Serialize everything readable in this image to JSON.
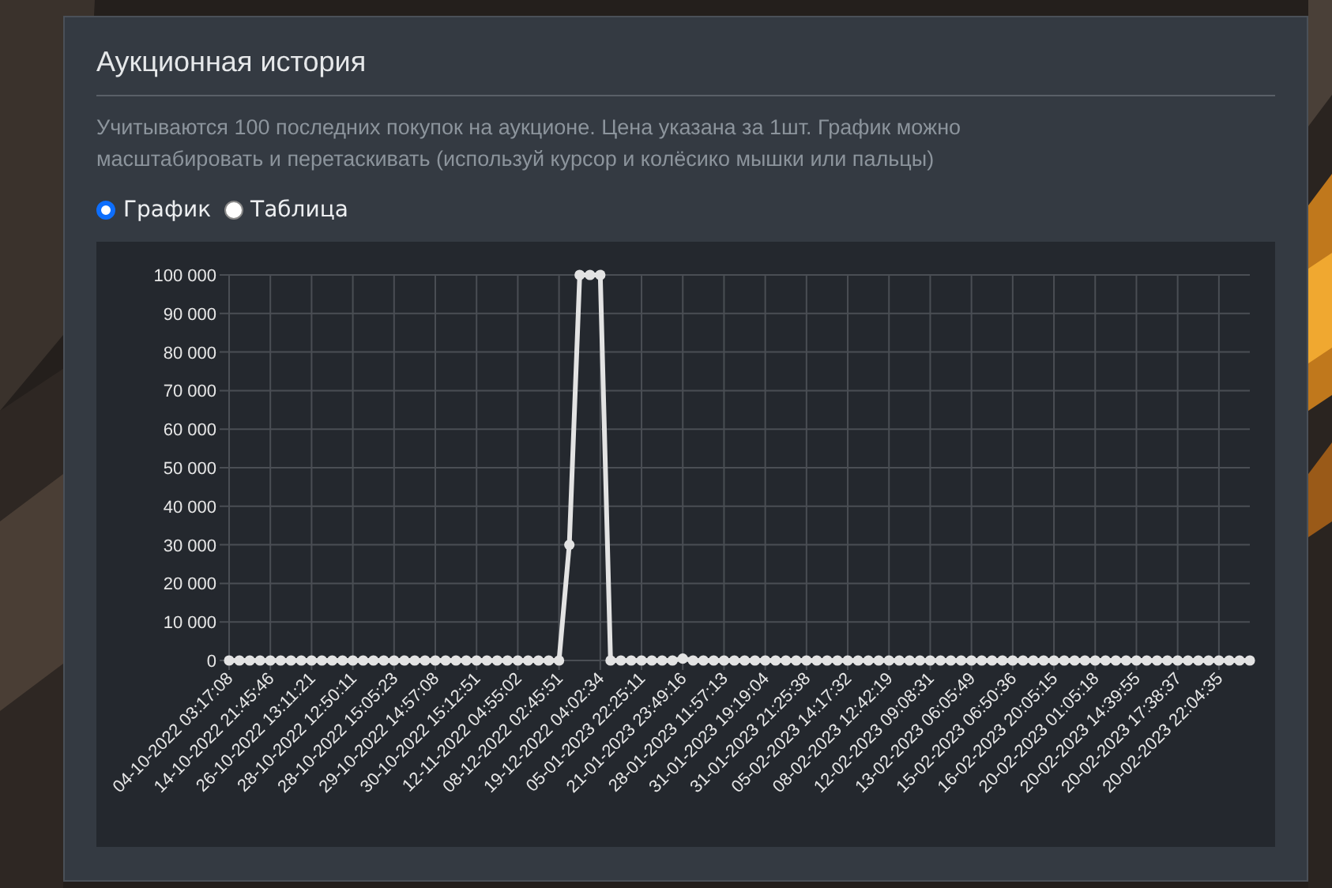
{
  "panel": {
    "title": "Аукционная история",
    "description": "Учитываются 100 последних покупок на аукционе. Цена указана за 1шт. График можно масштабировать и перетаскивать (используй курсор и колёсико мышки или пальцы)",
    "view_options": [
      {
        "label": "График",
        "selected": true
      },
      {
        "label": "Таблица",
        "selected": false
      }
    ],
    "chart_data": {
      "type": "line",
      "grid": true,
      "ylim": [
        0,
        100000
      ],
      "yticks": [
        {
          "value": 0,
          "label": "0"
        },
        {
          "value": 10000,
          "label": "10 000"
        },
        {
          "value": 20000,
          "label": "20 000"
        },
        {
          "value": 30000,
          "label": "30 000"
        },
        {
          "value": 40000,
          "label": "40 000"
        },
        {
          "value": 50000,
          "label": "50 000"
        },
        {
          "value": 60000,
          "label": "60 000"
        },
        {
          "value": 70000,
          "label": "70 000"
        },
        {
          "value": 80000,
          "label": "80 000"
        },
        {
          "value": 90000,
          "label": "90 000"
        },
        {
          "value": 100000,
          "label": "100 000"
        }
      ],
      "categories": [
        "04-10-2022 03:17:08",
        null,
        null,
        null,
        "14-10-2022 21:45:46",
        null,
        null,
        null,
        "26-10-2022 13:11:21",
        null,
        null,
        null,
        "28-10-2022 12:50:11",
        null,
        null,
        null,
        "28-10-2022 15:05:23",
        null,
        null,
        null,
        "29-10-2022 14:57:08",
        null,
        null,
        null,
        "30-10-2022 15:12:51",
        null,
        null,
        null,
        "12-11-2022 04:55:02",
        null,
        null,
        null,
        "08-12-2022 02:45:51",
        null,
        null,
        null,
        "19-12-2022 04:02:34",
        null,
        null,
        null,
        "05-01-2023 22:25:11",
        null,
        null,
        null,
        "21-01-2023 23:49:16",
        null,
        null,
        null,
        "28-01-2023 11:57:13",
        null,
        null,
        null,
        "31-01-2023 19:19:04",
        null,
        null,
        null,
        "31-01-2023 21:25:38",
        null,
        null,
        null,
        "05-02-2023 14:17:32",
        null,
        null,
        null,
        "08-02-2023 12:42:19",
        null,
        null,
        null,
        "12-02-2023 09:08:31",
        null,
        null,
        null,
        "13-02-2023 06:05:49",
        null,
        null,
        null,
        "15-02-2023 06:50:36",
        null,
        null,
        null,
        "16-02-2023 20:05:15",
        null,
        null,
        null,
        "20-02-2023 01:05:18",
        null,
        null,
        null,
        "20-02-2023 14:39:55",
        null,
        null,
        null,
        "20-02-2023 17:38:37",
        null,
        null,
        null,
        "20-02-2023 22:04:35",
        null,
        null,
        null
      ],
      "series": [
        {
          "color": "#e3e3e3",
          "marker": "circle",
          "values": [
            0,
            0,
            0,
            0,
            0,
            0,
            0,
            0,
            0,
            0,
            0,
            0,
            0,
            0,
            0,
            0,
            0,
            0,
            0,
            0,
            0,
            0,
            0,
            0,
            0,
            0,
            0,
            0,
            0,
            0,
            0,
            0,
            0,
            30000,
            100000,
            100000,
            100000,
            0,
            0,
            0,
            0,
            0,
            0,
            0,
            500,
            0,
            0,
            0,
            0,
            0,
            0,
            0,
            0,
            0,
            0,
            0,
            0,
            0,
            0,
            0,
            0,
            0,
            0,
            0,
            0,
            0,
            0,
            0,
            0,
            0,
            0,
            0,
            0,
            0,
            0,
            0,
            0,
            0,
            0,
            0,
            0,
            0,
            0,
            0,
            0,
            0,
            0,
            0,
            0,
            0,
            0,
            0,
            0,
            0,
            0,
            0,
            0,
            0,
            0,
            0
          ]
        }
      ]
    }
  }
}
